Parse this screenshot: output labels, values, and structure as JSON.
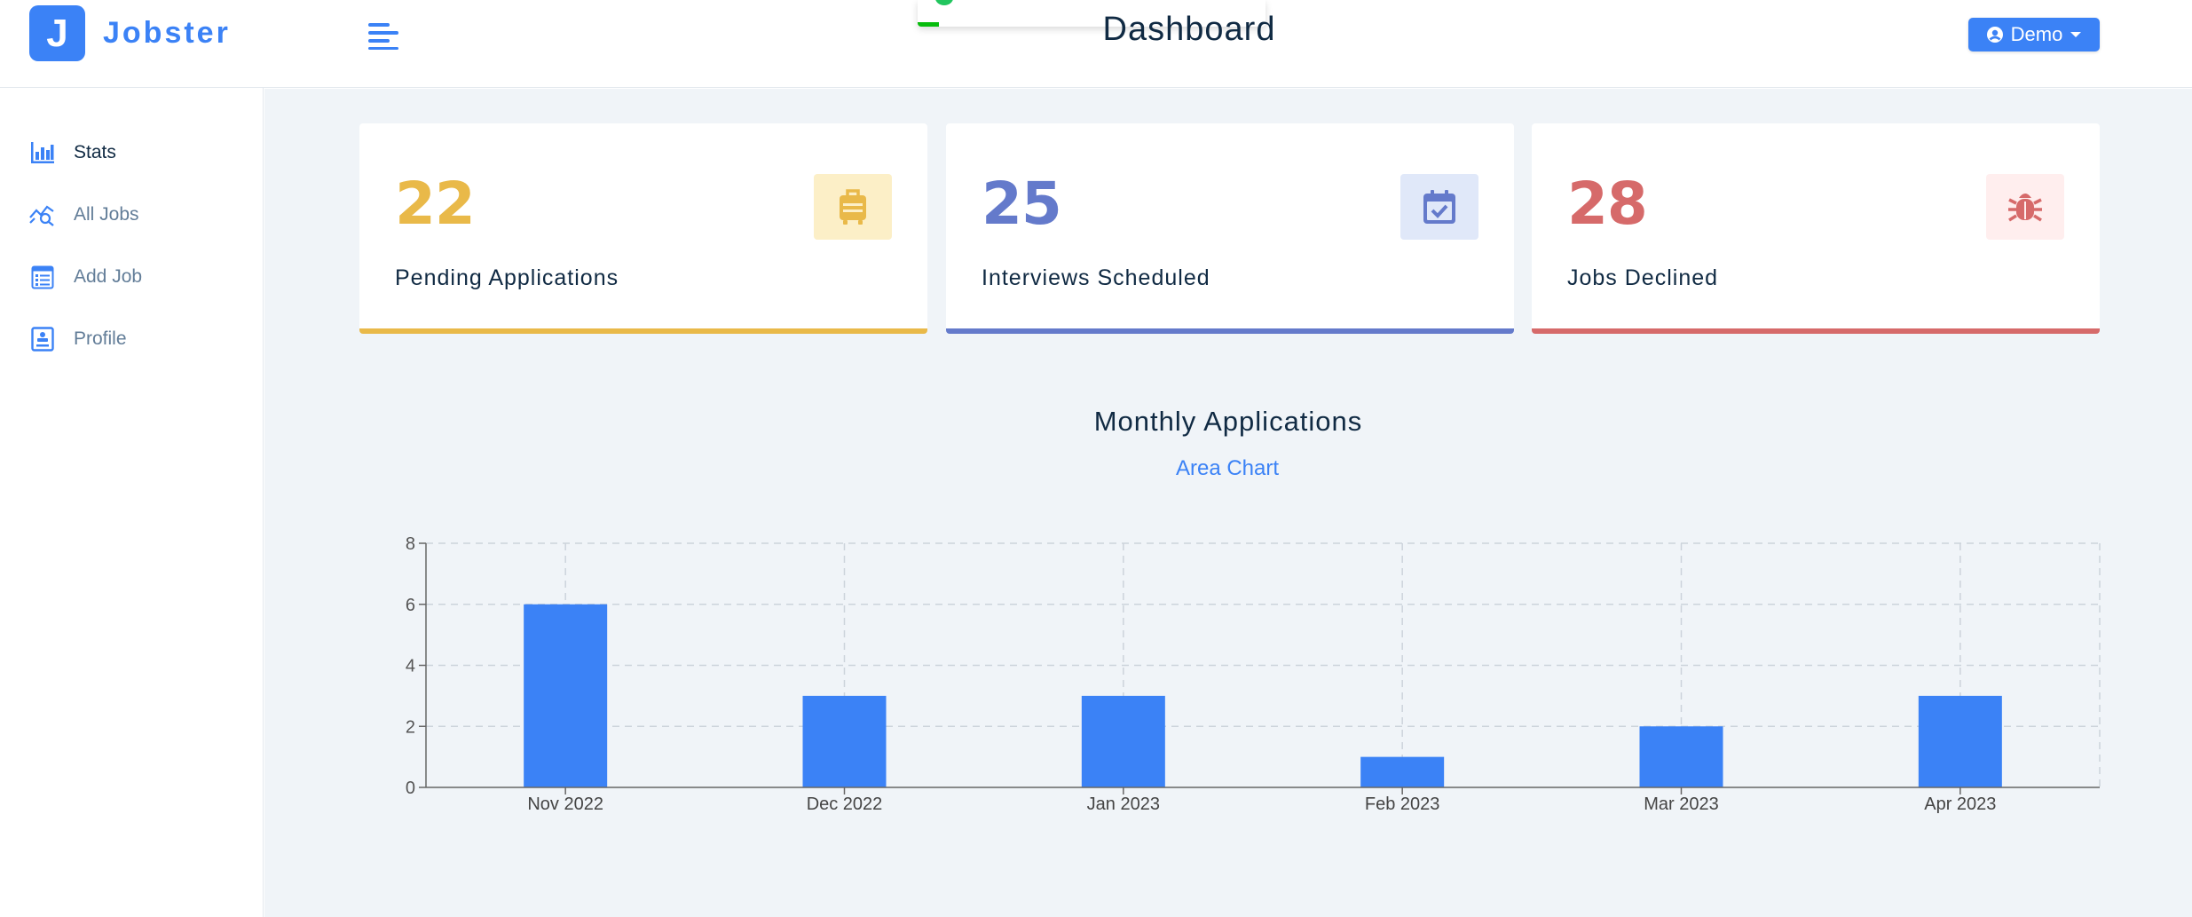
{
  "app": {
    "logo_letter": "J",
    "logo_name": "Jobster"
  },
  "header": {
    "title": "Dashboard",
    "user_label": "Demo"
  },
  "sidebar": {
    "items": [
      {
        "label": "Stats",
        "icon": "bar-chart-icon"
      },
      {
        "label": "All Jobs",
        "icon": "search-chart-icon"
      },
      {
        "label": "Add Job",
        "icon": "form-icon"
      },
      {
        "label": "Profile",
        "icon": "profile-card-icon"
      }
    ]
  },
  "stats": [
    {
      "count": "22",
      "title": "Pending Applications",
      "color": "#e9b949",
      "bg": "#fcefc7",
      "icon": "suitcase-icon"
    },
    {
      "count": "25",
      "title": "Interviews Scheduled",
      "color": "#647acb",
      "bg": "#e0e8f9",
      "icon": "calendar-check-icon"
    },
    {
      "count": "28",
      "title": "Jobs Declined",
      "color": "#d66a6a",
      "bg": "#ffeeee",
      "icon": "bug-icon"
    }
  ],
  "chart_section": {
    "title": "Monthly Applications",
    "toggle_label": "Area Chart"
  },
  "chart_data": {
    "type": "bar",
    "categories": [
      "Nov 2022",
      "Dec 2022",
      "Jan 2023",
      "Feb 2023",
      "Mar 2023",
      "Apr 2023"
    ],
    "values": [
      6,
      3,
      3,
      1,
      2,
      3
    ],
    "ylim": [
      0,
      8
    ],
    "yticks": [
      0,
      2,
      4,
      6,
      8
    ],
    "grid": true,
    "bar_color": "#3b82f6"
  }
}
